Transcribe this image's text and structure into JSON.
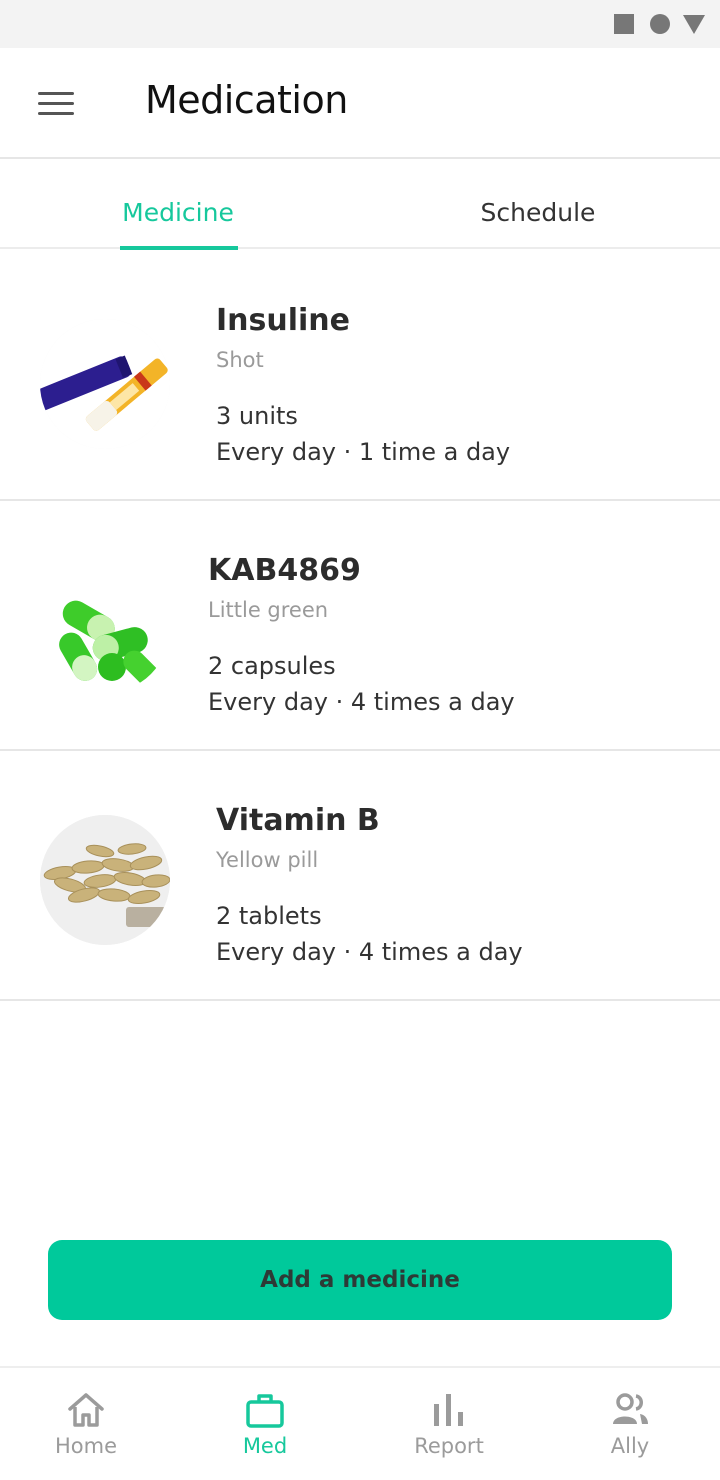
{
  "app": {
    "title": "Medication",
    "accent_color": "#16c89c",
    "button_color": "#00c99b"
  },
  "status_bar": {
    "icons": [
      "square-icon",
      "circle-icon",
      "triangle-icon"
    ]
  },
  "tabs": [
    {
      "label": "Medicine",
      "active": true
    },
    {
      "label": "Schedule",
      "active": false
    }
  ],
  "medicines": [
    {
      "name": "Insuline",
      "type": "Shot",
      "dose": "3 units",
      "frequency": "Every day · 1 time a day",
      "image": "insulin-pen-image"
    },
    {
      "name": "KAB4869",
      "type": "Little green",
      "dose": "2 capsules",
      "frequency": "Every day · 4 times a day",
      "image": "green-capsules-image"
    },
    {
      "name": "Vitamin B",
      "type": "Yellow pill",
      "dose": "2 tablets",
      "frequency": "Every day · 4 times a day",
      "image": "yellow-pills-image"
    }
  ],
  "add_button": {
    "label": "Add a medicine"
  },
  "bottom_nav": [
    {
      "label": "Home",
      "icon": "home-icon",
      "active": false
    },
    {
      "label": "Med",
      "icon": "briefcase-icon",
      "active": true
    },
    {
      "label": "Report",
      "icon": "bar-chart-icon",
      "active": false
    },
    {
      "label": "Ally",
      "icon": "people-icon",
      "active": false
    }
  ]
}
